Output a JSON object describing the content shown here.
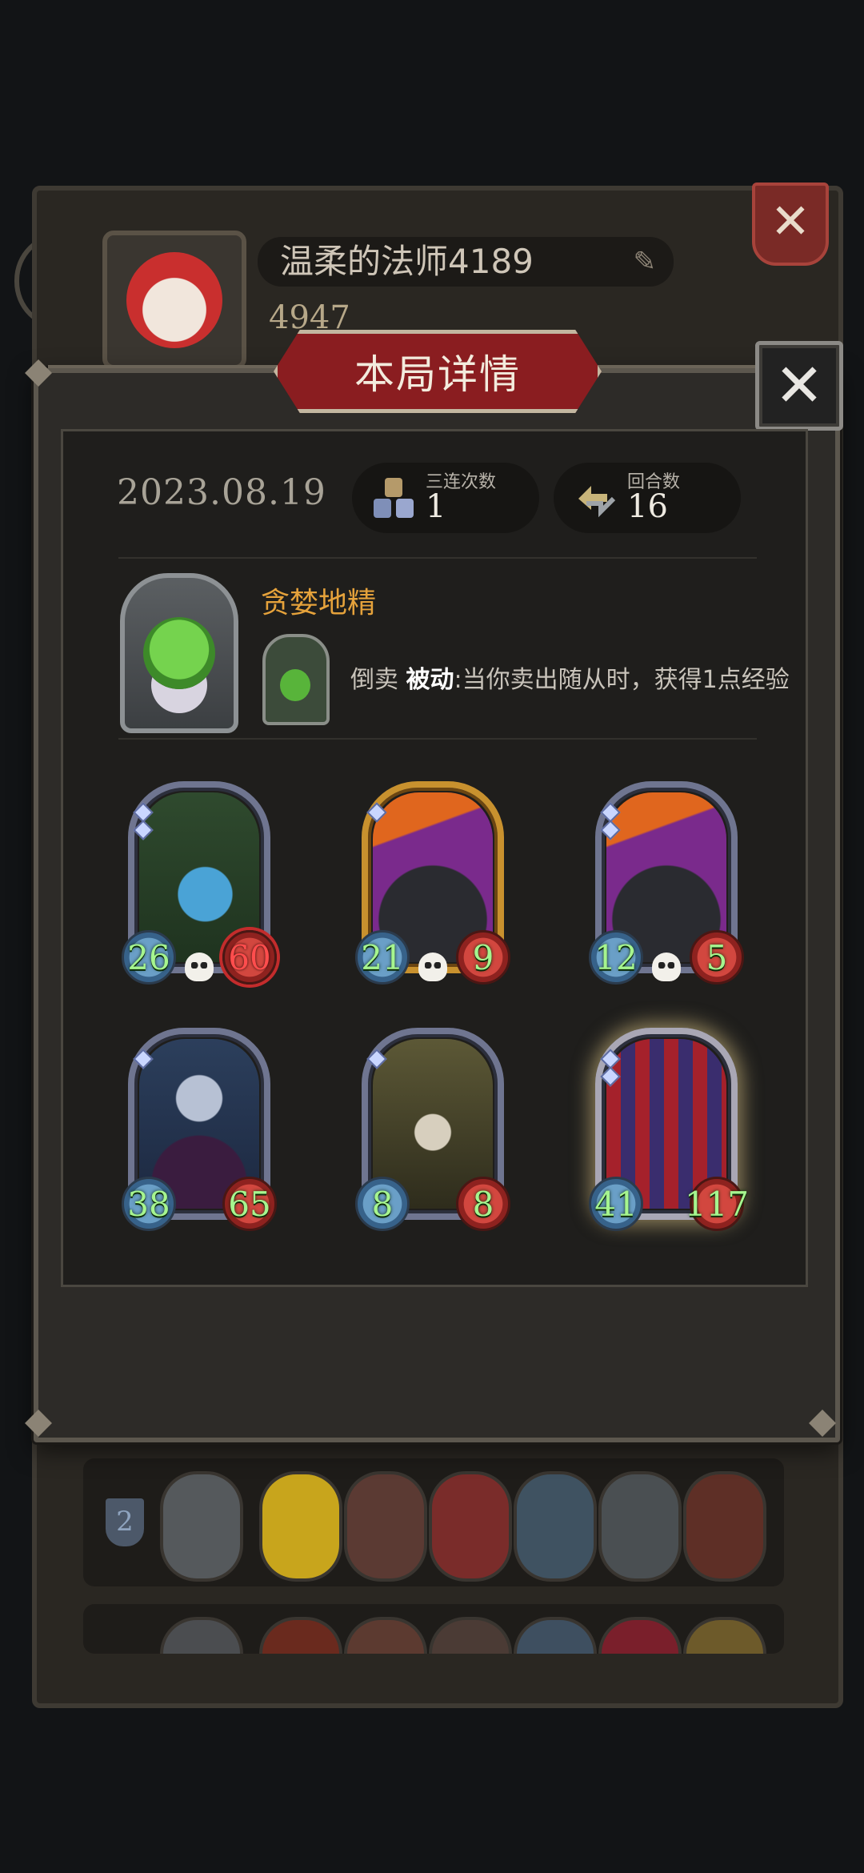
{
  "background": {
    "player_name": "温柔的法师4189",
    "coins": "4947",
    "rank_badge": "2"
  },
  "modal": {
    "title": "本局详情",
    "date": "2023.08.19",
    "stats": [
      {
        "label": "三连次数",
        "value": "1",
        "icon": "triple-blocks-icon"
      },
      {
        "label": "回合数",
        "value": "16",
        "icon": "rounds-arrows-icon"
      }
    ],
    "hero": {
      "name": "贪婪地精",
      "skill_prefix": "倒卖",
      "skill_keyword": "被动",
      "skill_text": ":当你卖出随从时，获得1点经验"
    },
    "minions": [
      {
        "name": "vine-plant",
        "attack": "26",
        "health": "60",
        "health_color": "red"
      },
      {
        "name": "fire-boar-gold",
        "attack": "21",
        "health": "9",
        "health_color": "green"
      },
      {
        "name": "fire-boar",
        "attack": "12",
        "health": "5",
        "health_color": "green"
      },
      {
        "name": "elf-sorceress",
        "attack": "38",
        "health": "65",
        "health_color": "green"
      },
      {
        "name": "hooded-elder",
        "attack": "8",
        "health": "8",
        "health_color": "green"
      },
      {
        "name": "jester-clown",
        "attack": "41",
        "health": "117",
        "health_color": "green"
      }
    ]
  },
  "colors": {
    "hero_name": "#e5a23b",
    "stat_number": "#a6f58f",
    "banner_red": "#8a1d20"
  }
}
